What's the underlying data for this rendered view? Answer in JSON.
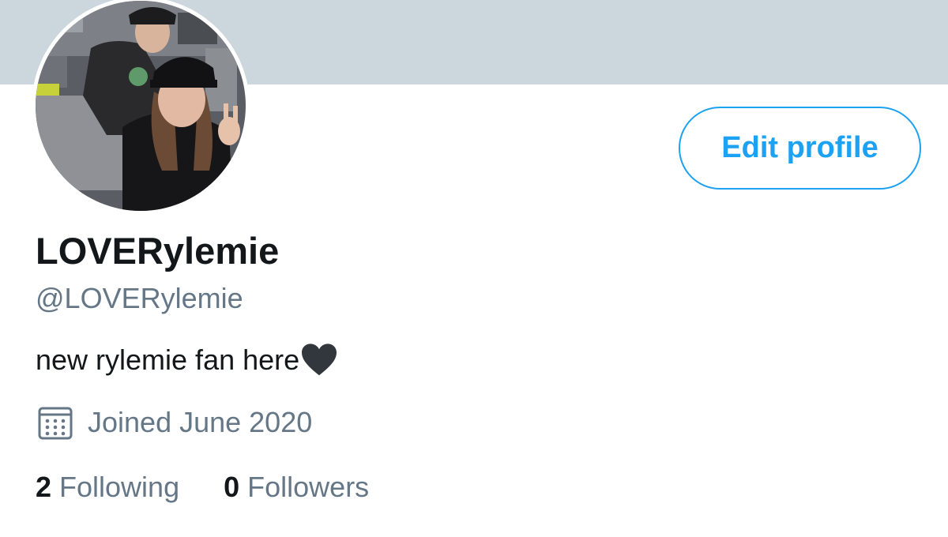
{
  "profile": {
    "display_name": "LOVERylemie",
    "handle": "@LOVERylemie",
    "bio": "new rylemie fan here",
    "joined": "Joined June 2020"
  },
  "actions": {
    "edit_profile_label": "Edit profile"
  },
  "stats": {
    "following": {
      "count": "2",
      "label": "Following"
    },
    "followers": {
      "count": "0",
      "label": "Followers"
    }
  },
  "icons": {
    "bio_emoji": "black-heart-icon",
    "joined": "calendar-icon"
  },
  "colors": {
    "banner": "#ccd6dd",
    "accent": "#1da1f2",
    "primary_text": "#14171a",
    "secondary_text": "#657786"
  }
}
